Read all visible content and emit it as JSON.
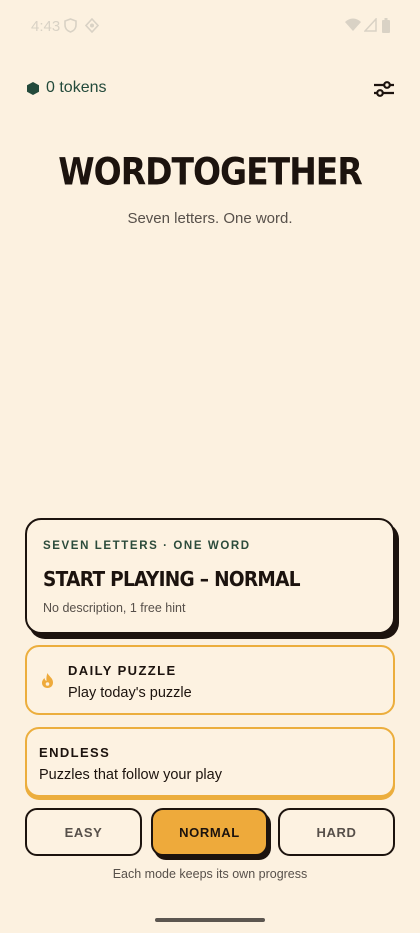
{
  "status_bar": {
    "time": "4:43",
    "left_icons": [
      "shield-icon",
      "vpn-key-icon"
    ],
    "right_icons": [
      "wifi-icon",
      "signal-icon",
      "battery-icon"
    ]
  },
  "header": {
    "token_icon": "hexagon-token-icon",
    "token_count": "0 tokens",
    "settings_icon": "sliders-icon"
  },
  "app": {
    "title": "WORDTOGETHER",
    "subtitle": "Seven letters. One word."
  },
  "main_card": {
    "eyebrow": "SEVEN LETTERS · ONE WORD",
    "title": "START PLAYING – NORMAL",
    "description": "No description, 1 free hint"
  },
  "daily_card": {
    "icon": "flame-icon",
    "title": "DAILY PUZZLE",
    "description": "Play today's puzzle"
  },
  "endless_card": {
    "title": "ENDLESS",
    "description": "Puzzles that follow your play"
  },
  "modes": {
    "options": [
      "EASY",
      "NORMAL",
      "HARD"
    ],
    "selected": "NORMAL",
    "note": "Each mode keeps its own progress"
  },
  "colors": {
    "background": "#fcf1e0",
    "ink": "#1c130e",
    "accent": "#eeaa3b",
    "green": "#234a3b",
    "muted": "#57504a"
  }
}
